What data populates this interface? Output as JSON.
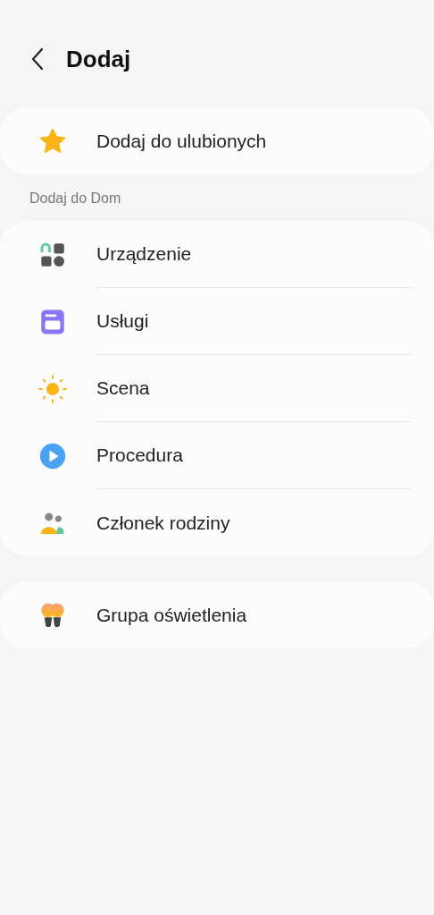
{
  "header": {
    "title": "Dodaj"
  },
  "favorites": [
    {
      "kind": "star",
      "label": "Dodaj do ulubionych"
    }
  ],
  "section": {
    "title": "Dodaj do Dom",
    "items": [
      {
        "kind": "device",
        "label": "Urządzenie"
      },
      {
        "kind": "service",
        "label": "Usługi"
      },
      {
        "kind": "scene",
        "label": "Scena"
      },
      {
        "kind": "routine",
        "label": "Procedura"
      },
      {
        "kind": "family",
        "label": "Członek rodziny"
      }
    ]
  },
  "extra": [
    {
      "kind": "lights",
      "label": "Grupa oświetlenia"
    }
  ]
}
